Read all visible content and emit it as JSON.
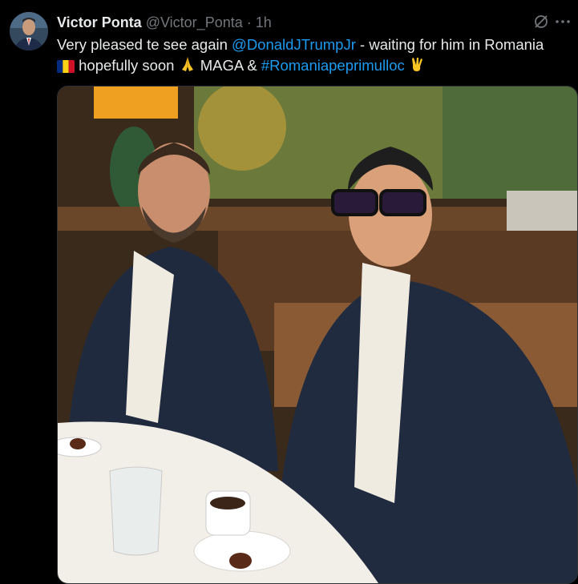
{
  "tweet": {
    "author_name": "Victor Ponta",
    "author_handle": "@Victor_Ponta",
    "separator": "·",
    "time": "1h",
    "text_part1": "Very pleased te see again ",
    "mention": "@DonaldJTrumpJr",
    "text_part2": " - waiting for him in Romania",
    "text_part3": " hopefully soon ",
    "text_part4": " MAGA  & ",
    "hashtag": "#Romaniapeprimulloc",
    "emojis": [
      "romania-flag-icon",
      "folded-hands-icon",
      "victory-hand-icon"
    ]
  },
  "colors": {
    "background": "#000000",
    "text": "#e7e9ea",
    "muted": "#71767b",
    "link": "#1d9bf0",
    "border": "#2f3336"
  },
  "icons": [
    "grok-icon",
    "more-icon"
  ]
}
